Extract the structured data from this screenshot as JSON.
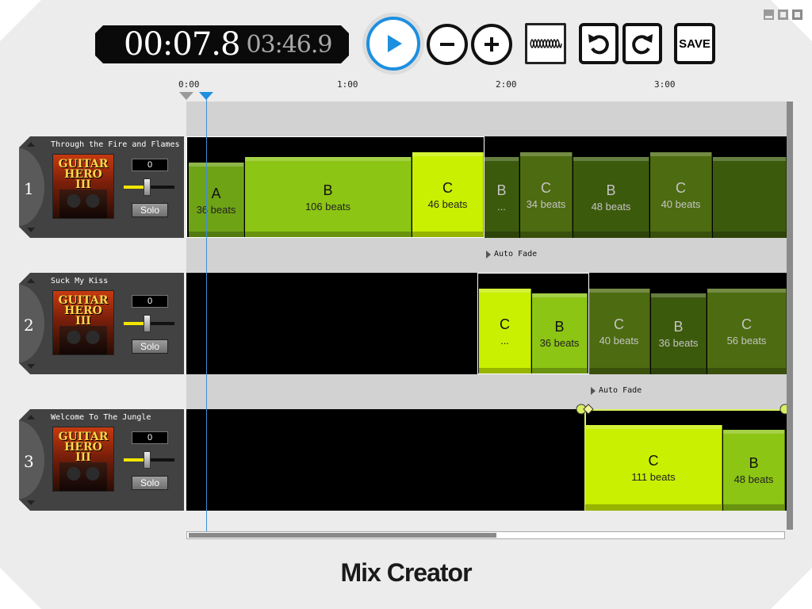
{
  "app": {
    "title": "Mix Creator"
  },
  "transport": {
    "current_time": "00:07.8",
    "total_time": "03:46.9",
    "save_label": "SAVE"
  },
  "ruler": {
    "ticks": [
      "0:00",
      "1:00",
      "2:00",
      "3:00"
    ]
  },
  "tracks": [
    {
      "number": "1",
      "name": "Through the Fire and Flames",
      "cover_text": "GUITAR HERO III",
      "volume": "0",
      "volume_level": 0.45,
      "solo_label": "Solo",
      "segments": [
        {
          "section": "A",
          "beats": "36 beats",
          "color": "#6fa316"
        },
        {
          "section": "B",
          "beats": "106 beats",
          "color": "#8cc514"
        },
        {
          "section": "C",
          "beats": "46 beats",
          "color": "#c8f000"
        },
        {
          "section": "B",
          "beats": "...",
          "color": "#3c5a0c"
        },
        {
          "section": "C",
          "beats": "34 beats",
          "color": "#4d6b10"
        },
        {
          "section": "B",
          "beats": "48 beats",
          "color": "#3c5a0c"
        },
        {
          "section": "C",
          "beats": "40 beats",
          "color": "#4d6b10"
        },
        {
          "section": "",
          "beats": "",
          "color": "#3c5a0c"
        }
      ],
      "fade_label": "Auto Fade"
    },
    {
      "number": "2",
      "name": "Suck My Kiss",
      "cover_text": "GUITAR HERO III",
      "volume": "0",
      "volume_level": 0.45,
      "solo_label": "Solo",
      "segments": [
        {
          "section": "C",
          "beats": "...",
          "color": "#c8f000"
        },
        {
          "section": "B",
          "beats": "36 beats",
          "color": "#8cc514"
        },
        {
          "section": "C",
          "beats": "40 beats",
          "color": "#4d6b10"
        },
        {
          "section": "B",
          "beats": "36 beats",
          "color": "#3c5a0c"
        },
        {
          "section": "C",
          "beats": "56 beats",
          "color": "#4d6b10"
        }
      ],
      "fade_label": "Auto Fade"
    },
    {
      "number": "3",
      "name": "Welcome To The Jungle",
      "cover_text": "GUITAR HERO III",
      "volume": "0",
      "volume_level": 0.45,
      "solo_label": "Solo",
      "segments": [
        {
          "section": "C",
          "beats": "111 beats",
          "color": "#c8f000"
        },
        {
          "section": "B",
          "beats": "48 beats",
          "color": "#8cc514"
        }
      ]
    }
  ]
}
